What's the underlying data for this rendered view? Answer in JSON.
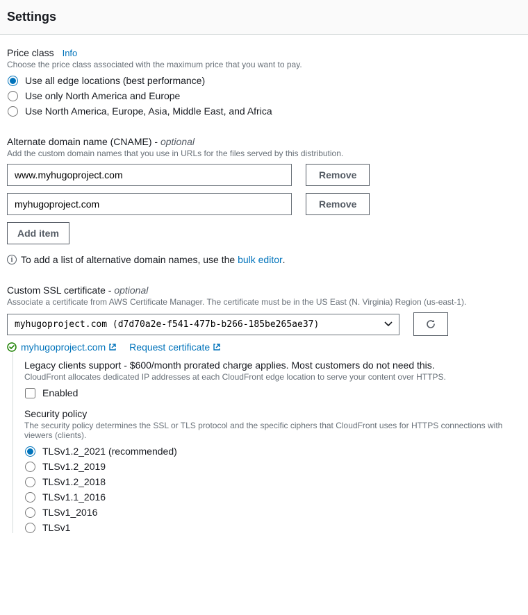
{
  "header": {
    "title": "Settings"
  },
  "priceClass": {
    "label": "Price class",
    "infoLink": "Info",
    "hint": "Choose the price class associated with the maximum price that you want to pay.",
    "options": [
      "Use all edge locations (best performance)",
      "Use only North America and Europe",
      "Use North America, Europe, Asia, Middle East, and Africa"
    ],
    "selected": 0
  },
  "cname": {
    "label": "Alternate domain name (CNAME) - ",
    "optional": "optional",
    "hint": "Add the custom domain names that you use in URLs for the files served by this distribution.",
    "items": [
      {
        "value": "www.myhugoproject.com"
      },
      {
        "value": "myhugoproject.com"
      }
    ],
    "removeLabel": "Remove",
    "addLabel": "Add item",
    "bulkPrefix": "To add a list of alternative domain names, use the ",
    "bulkLinkText": "bulk editor",
    "bulkSuffix": "."
  },
  "ssl": {
    "label": "Custom SSL certificate - ",
    "optional": "optional",
    "hint": "Associate a certificate from AWS Certificate Manager. The certificate must be in the US East (N. Virginia) Region (us-east-1).",
    "selected": "myhugoproject.com (d7d70a2e-f541-477b-b266-185be265ae37)",
    "verifiedDomain": "myhugoproject.com",
    "requestLabel": "Request certificate"
  },
  "legacy": {
    "title": "Legacy clients support - $600/month prorated charge applies. Most customers do not need this.",
    "hint": "CloudFront allocates dedicated IP addresses at each CloudFront edge location to serve your content over HTTPS.",
    "checkboxLabel": "Enabled",
    "checked": false
  },
  "securityPolicy": {
    "title": "Security policy",
    "hint": "The security policy determines the SSL or TLS protocol and the specific ciphers that CloudFront uses for HTTPS connections with viewers (clients).",
    "options": [
      "TLSv1.2_2021 (recommended)",
      "TLSv1.2_2019",
      "TLSv1.2_2018",
      "TLSv1.1_2016",
      "TLSv1_2016",
      "TLSv1"
    ],
    "selected": 0
  }
}
